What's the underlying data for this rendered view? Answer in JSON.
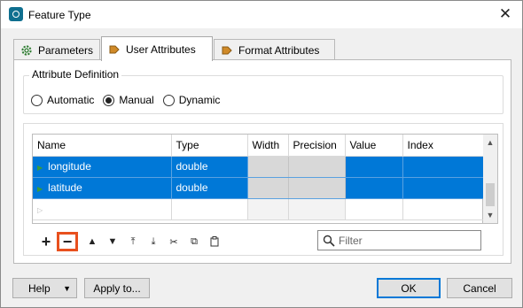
{
  "window": {
    "title": "Feature Type",
    "close_icon": "close-icon"
  },
  "tabs": [
    {
      "label": "Parameters",
      "icon": "gear-icon",
      "active": false
    },
    {
      "label": "User Attributes",
      "icon": "arrow-right-icon",
      "active": true
    },
    {
      "label": "Format Attributes",
      "icon": "arrow-right-icon",
      "active": false
    }
  ],
  "attribute_definition": {
    "title": "Attribute Definition",
    "options": [
      {
        "label": "Automatic",
        "checked": false
      },
      {
        "label": "Manual",
        "checked": true
      },
      {
        "label": "Dynamic",
        "checked": false
      }
    ]
  },
  "table": {
    "columns": [
      "Name",
      "Type",
      "Width",
      "Precision",
      "Value",
      "Index"
    ],
    "rows": [
      {
        "name": "longitude",
        "type": "double",
        "width": "",
        "precision": "",
        "value": "",
        "index": "",
        "selected": true
      },
      {
        "name": "latitude",
        "type": "double",
        "width": "",
        "precision": "",
        "value": "",
        "index": "",
        "selected": true
      },
      {
        "name": "",
        "type": "",
        "width": "",
        "precision": "",
        "value": "",
        "index": "",
        "selected": false
      }
    ]
  },
  "toolbar": {
    "add": "+",
    "remove": "−",
    "move_up": "▲",
    "move_down": "▼",
    "move_top": "⤒",
    "move_bottom": "⤓",
    "cut": "✂",
    "copy": "⧉",
    "paste": "📋"
  },
  "filter": {
    "placeholder": "Filter"
  },
  "buttons": {
    "help": "Help",
    "help_dropdown": "▼",
    "apply_to": "Apply to...",
    "ok": "OK",
    "cancel": "Cancel"
  },
  "colors": {
    "selection": "#0078d7",
    "highlight": "#e8501e"
  }
}
